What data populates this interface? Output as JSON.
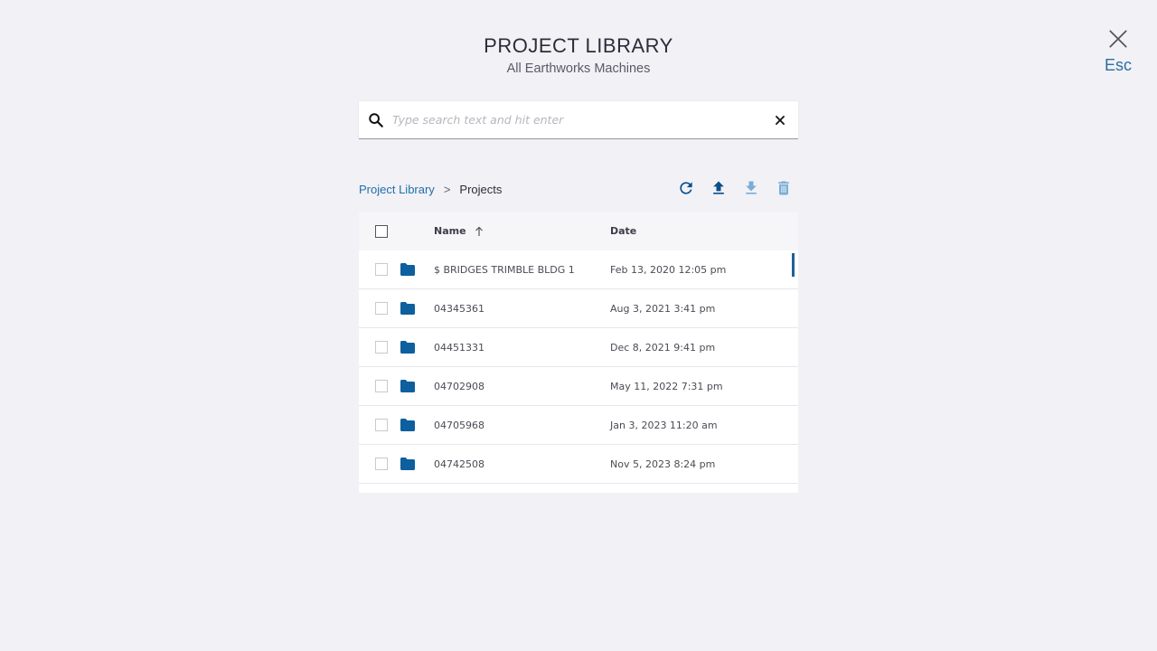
{
  "header": {
    "title": "PROJECT LIBRARY",
    "subtitle": "All Earthworks Machines"
  },
  "close": {
    "icon": "close-icon",
    "esc_label": "Esc"
  },
  "search": {
    "placeholder": "Type search text and hit enter",
    "value": "",
    "icon": "search-icon",
    "clear_icon": "close-icon"
  },
  "breadcrumb": {
    "root": "Project Library",
    "separator": ">",
    "current": "Projects"
  },
  "toolbar": [
    "refresh-icon",
    "upload-icon",
    "download-icon",
    "delete-icon"
  ],
  "table": {
    "columns": {
      "name": "Name",
      "date": "Date"
    },
    "sort": "name-ascending",
    "rows": [
      {
        "name": "$ BRIDGES TRIMBLE BLDG 1",
        "date": "Feb 13, 2020 12:05 pm"
      },
      {
        "name": "04345361",
        "date": "Aug 3, 2021 3:41 pm"
      },
      {
        "name": "04451331",
        "date": "Dec 8, 2021 9:41 pm"
      },
      {
        "name": "04702908",
        "date": "May 11, 2022 7:31 pm"
      },
      {
        "name": "04705968",
        "date": "Jan 3, 2023 11:20 am"
      },
      {
        "name": "04742508",
        "date": "Nov 5, 2023 8:24 pm"
      }
    ]
  },
  "colors": {
    "background": "#f1f1f6",
    "accent": "#1f70a8",
    "folder": "#0d5f9e",
    "icon_dark": "#0a4f8a",
    "icon_light": "#7aaed6"
  }
}
